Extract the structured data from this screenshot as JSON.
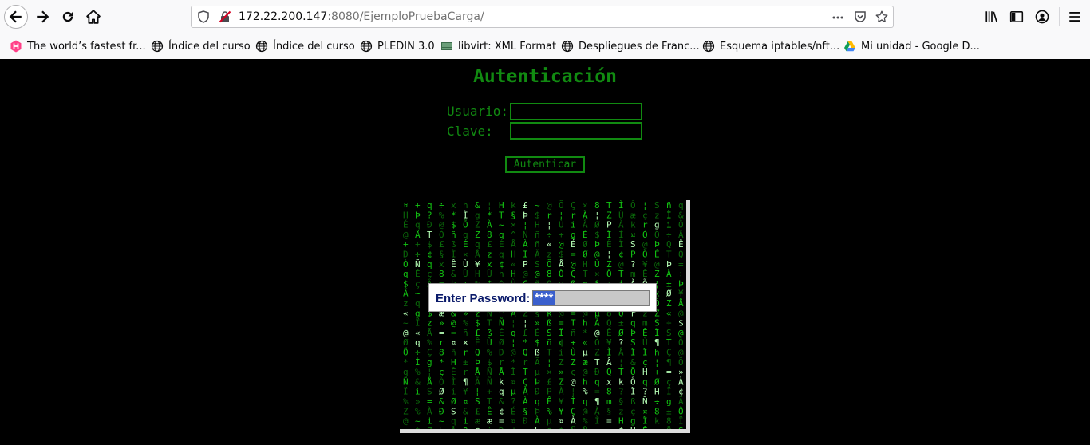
{
  "browser": {
    "url_host": "172.22.200.147",
    "url_rest": ":8080/EjemploPruebaCarga/",
    "icons": {
      "back": "arrow-left-icon",
      "forward": "arrow-right-icon",
      "reload": "reload-icon",
      "home": "home-icon",
      "site_info": "shield-icon",
      "insecure": "insecure-lock-icon",
      "page_actions": "more-horizontal-icon",
      "pocket": "pocket-icon",
      "bookmark": "star-icon",
      "library": "library-icon",
      "sidebar": "sidebar-icon",
      "account": "account-icon",
      "menu": "hamburger-menu-icon"
    },
    "bookmarks": [
      {
        "label": "The world’s fastest fr...",
        "icon": "hugo-icon"
      },
      {
        "label": "Índice del curso",
        "icon": "globe-icon"
      },
      {
        "label": "Índice del curso",
        "icon": "globe-icon"
      },
      {
        "label": "PLEDIN 3.0",
        "icon": "globe-icon"
      },
      {
        "label": "libvirt: XML Format",
        "icon": "libvirt-icon"
      },
      {
        "label": "Despliegues de Franc...",
        "icon": "globe-icon"
      },
      {
        "label": "Esquema iptables/nft...",
        "icon": "globe-icon"
      },
      {
        "label": "Mi unidad - Google D...",
        "icon": "google-drive-icon"
      }
    ]
  },
  "page": {
    "title": "Autenticacion",
    "title_display": "Autenticación",
    "user_label": "Usuario:",
    "pass_label": "Clave:",
    "user_value": "",
    "pass_value": "",
    "submit_label": "Autenticar",
    "accent_color": "#118a11",
    "background_color": "#000000"
  },
  "image": {
    "dialog_label": "Enter Password:",
    "dialog_value": "****",
    "matrix_color": "#0fd00f"
  }
}
